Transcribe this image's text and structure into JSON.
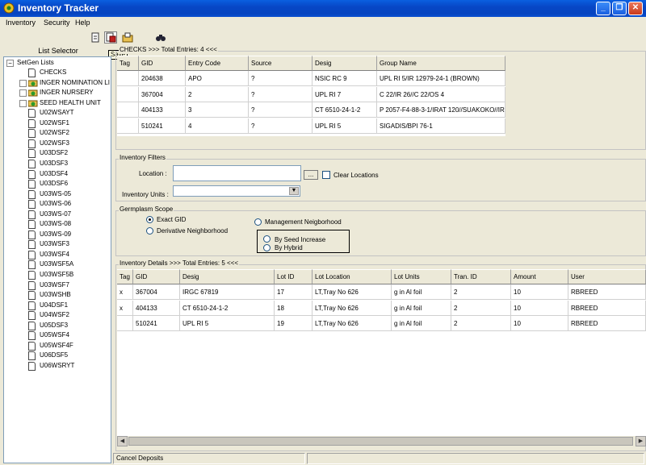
{
  "window": {
    "title": "Inventory Tracker"
  },
  "menu": {
    "items": [
      "Inventory",
      "Security",
      "Help"
    ]
  },
  "toolbar": {
    "tooltip": "Save",
    "icons": [
      "new-doc-icon",
      "save-icon",
      "open-icon",
      "binoculars-icon"
    ]
  },
  "list_selector": {
    "header": "List Selector",
    "root": "SetGen Lists",
    "items": [
      {
        "label": "CHECKS",
        "type": "doc"
      },
      {
        "label": "INGER NOMINATION LI",
        "type": "folder"
      },
      {
        "label": "INGER NURSERY",
        "type": "folder"
      },
      {
        "label": "SEED HEALTH UNIT",
        "type": "folder"
      },
      {
        "label": "U02WSAYT",
        "type": "doc"
      },
      {
        "label": "U02WSF1",
        "type": "doc"
      },
      {
        "label": "U02WSF2",
        "type": "doc"
      },
      {
        "label": "U02WSF3",
        "type": "doc"
      },
      {
        "label": "U03DSF2",
        "type": "doc"
      },
      {
        "label": "U03DSF3",
        "type": "doc"
      },
      {
        "label": "U03DSF4",
        "type": "doc"
      },
      {
        "label": "U03DSF6",
        "type": "doc"
      },
      {
        "label": "U03WS-05",
        "type": "doc"
      },
      {
        "label": "U03WS-06",
        "type": "doc"
      },
      {
        "label": "U03WS-07",
        "type": "doc"
      },
      {
        "label": "U03WS-08",
        "type": "doc"
      },
      {
        "label": "U03WS-09",
        "type": "doc"
      },
      {
        "label": "U03WSF3",
        "type": "doc"
      },
      {
        "label": "U03WSF4",
        "type": "doc"
      },
      {
        "label": "U03WSF5A",
        "type": "doc"
      },
      {
        "label": "U03WSF5B",
        "type": "doc"
      },
      {
        "label": "U03WSF7",
        "type": "doc"
      },
      {
        "label": "U03WSHB",
        "type": "doc"
      },
      {
        "label": "U04DSF1",
        "type": "doc"
      },
      {
        "label": "U04WSF2",
        "type": "doc"
      },
      {
        "label": "U05DSF3",
        "type": "doc"
      },
      {
        "label": "U05WSF4",
        "type": "doc"
      },
      {
        "label": "U05WSF4F",
        "type": "doc"
      },
      {
        "label": "U06DSF5",
        "type": "doc"
      },
      {
        "label": "U06WSRYT",
        "type": "doc"
      }
    ]
  },
  "checks": {
    "legend": "CHECKS >>> Total Entries: 4 <<<",
    "columns": [
      "Tag",
      "GID",
      "Entry Code",
      "Source",
      "Desig",
      "Group Name"
    ],
    "rows": [
      [
        "",
        "204638",
        "APO",
        "?",
        "NSIC RC 9",
        "UPL RI 5/IR 12979-24-1 (BROWN)"
      ],
      [
        "",
        "367004",
        "2",
        "?",
        "UPL RI 7",
        "C 22/IR 26//C 22/OS 4"
      ],
      [
        "",
        "404133",
        "3",
        "?",
        "CT 6510-24-1-2",
        "P 2057-F4-88-3-1/IRAT 120//SUAKOKO//IR"
      ],
      [
        "",
        "510241",
        "4",
        "?",
        "UPL RI 5",
        "SIGADIS/BPI 76-1"
      ]
    ]
  },
  "filters": {
    "legend": "Inventory Filters",
    "location_label": "Location :",
    "browse_label": "...",
    "clear_locations_label": "Clear Locations",
    "units_label": "Inventory Units :"
  },
  "scope": {
    "legend": "Germplasm Scope",
    "exact_gid": "Exact GID",
    "derivative": "Derivative Neighborhood",
    "management": "Management Neigborhood",
    "by_seed_increase": "By Seed Increase",
    "by_hybrid": "By Hybrid"
  },
  "details": {
    "legend": "Inventory Details >>> Total Entries: 5 <<<",
    "columns": [
      "Tag",
      "GID",
      "Desig",
      "Lot ID",
      "Lot Location",
      "Lot Units",
      "Tran. ID",
      "Amount",
      "User"
    ],
    "rows": [
      [
        "x",
        "367004",
        "IRGC 67819",
        "17",
        "LT,Tray No 626",
        "g in Al foil",
        "2",
        "10",
        "RBREED"
      ],
      [
        "x",
        "404133",
        "CT 6510-24-1-2",
        "18",
        "LT,Tray No 626",
        "g in Al foil",
        "2",
        "10",
        "RBREED"
      ],
      [
        "",
        "510241",
        "UPL RI 5",
        "19",
        "LT,Tray No 626",
        "g in Al foil",
        "2",
        "10",
        "RBREED"
      ]
    ]
  },
  "status": {
    "text": "Cancel Deposits"
  }
}
